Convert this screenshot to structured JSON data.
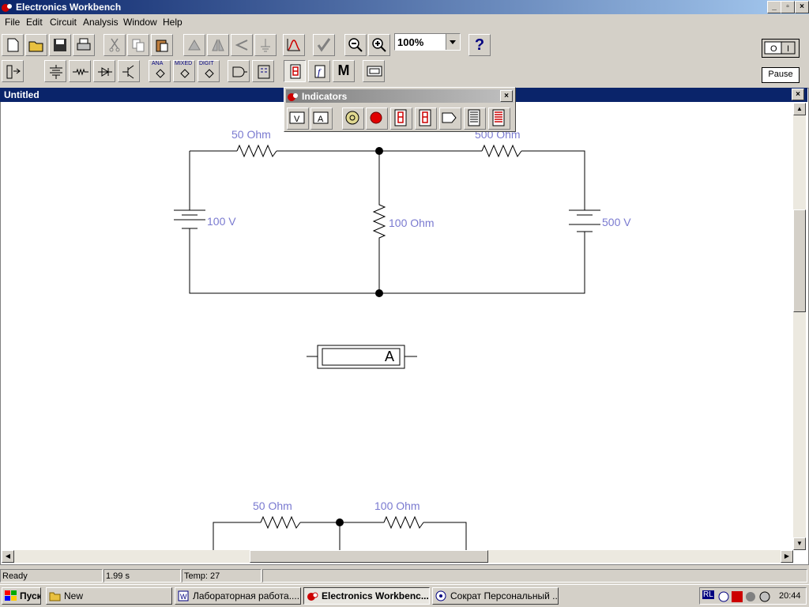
{
  "window": {
    "title": "Electronics Workbench"
  },
  "menu": [
    "File",
    "Edit",
    "Circuit",
    "Analysis",
    "Window",
    "Help"
  ],
  "toolbar": {
    "zoom": "100%",
    "help": "?",
    "pause": "Pause",
    "power": "O | I",
    "parts_labels": {
      "analog": "ANA",
      "mixed": "MIXED",
      "digital": "DIGIT",
      "misc": "M"
    }
  },
  "document": {
    "title": "Untitled"
  },
  "indicators": {
    "title": "Indicators",
    "voltmeter": "V",
    "ammeter": "A"
  },
  "circuit": {
    "r1": "50  Ohm",
    "r2": "500  Ohm",
    "r3": "100  Ohm",
    "v1": "100 V",
    "v2": "500 V",
    "ammeter": "A",
    "r4": "50  Ohm",
    "r5": "100  Ohm"
  },
  "status": {
    "state": "Ready",
    "time": "1.99 s",
    "temp": "Temp:  27"
  },
  "taskbar": {
    "start": "Пуск",
    "tasks": [
      "New",
      "Лабораторная работа....",
      "Electronics Workbenc...",
      "Сократ Персональный ..."
    ],
    "clock": "20:44",
    "lang": "RL"
  }
}
